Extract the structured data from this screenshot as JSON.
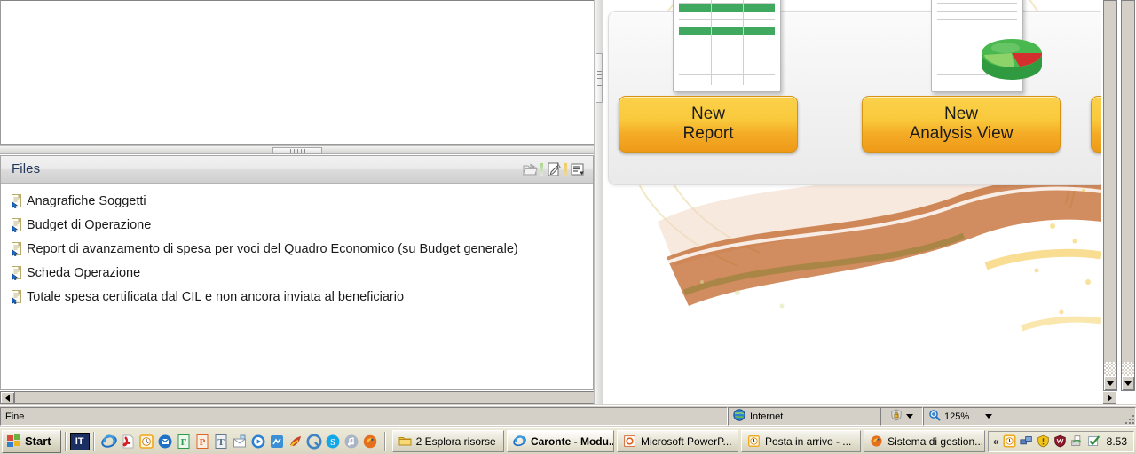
{
  "left_panel": {
    "top_pane": {
      "content": ""
    },
    "files_panel": {
      "title": "Files",
      "tools": [
        {
          "name": "open-folder-icon",
          "label": "Apri"
        },
        {
          "name": "edit-page-icon",
          "label": "Modifica"
        },
        {
          "name": "properties-list-icon",
          "label": "Proprietà"
        }
      ],
      "items": [
        {
          "icon": "document-shortcut-icon",
          "label": "Anagrafiche Soggetti"
        },
        {
          "icon": "document-shortcut-icon",
          "label": "Budget di Operazione"
        },
        {
          "icon": "document-shortcut-icon",
          "label": "Report di avanzamento di spesa per voci del Quadro Economico (su Budget generale)"
        },
        {
          "icon": "document-shortcut-icon",
          "label": "Scheda Operazione"
        },
        {
          "icon": "document-shortcut-icon",
          "label": "Totale spesa certificata dal CIL e non ancora inviata al beneficiario"
        }
      ]
    }
  },
  "main_pane": {
    "tiles": [
      {
        "id": "new-report",
        "line1": "New",
        "line2": "Report",
        "art": "spreadsheet-green"
      },
      {
        "id": "new-analysis-view",
        "line1": "New",
        "line2": "Analysis View",
        "art": "spreadsheet-pie"
      },
      {
        "id": "third-action",
        "line1": "",
        "line2": "",
        "art": "partial"
      }
    ]
  },
  "statusbar": {
    "message": "Fine",
    "zone": "Internet",
    "zone_icon": "globe-icon",
    "protected_icon": "lock-shield-icon",
    "zoom": "125%",
    "zoom_icon": "magnifier-plus-icon"
  },
  "taskbar": {
    "start_label": "Start",
    "language": "IT",
    "quicklaunch": [
      {
        "name": "internet-explorer-icon",
        "color": "#1f6fc4"
      },
      {
        "name": "acrobat-reader-icon",
        "color": "#d81f26"
      },
      {
        "name": "outlook-clock-icon",
        "color": "#f0a81e"
      },
      {
        "name": "outlook-icon",
        "color": "#1d72c8"
      },
      {
        "name": "frontpage-icon",
        "color": "#2e9a4a"
      },
      {
        "name": "powerpoint-icon",
        "color": "#e06425"
      },
      {
        "name": "word-icon",
        "color": "#64788c"
      },
      {
        "name": "mail-icon",
        "color": "#9aa3ad"
      },
      {
        "name": "media-player-icon",
        "color": "#2f7fd0"
      },
      {
        "name": "network-app-icon",
        "color": "#3b8fd6"
      },
      {
        "name": "ccleaner-icon",
        "color": "#c8442a"
      },
      {
        "name": "quicktime-icon",
        "color": "#3f83c4"
      },
      {
        "name": "skype-icon",
        "color": "#14a7e8"
      },
      {
        "name": "itunes-icon",
        "color": "#7f8fa4"
      },
      {
        "name": "firefox-icon",
        "color": "#e4701e"
      }
    ],
    "tasks": [
      {
        "icon": "folder-icon",
        "label": "2 Esplora risorse",
        "active": false,
        "group": true
      },
      {
        "icon": "internet-explorer-icon",
        "label": "Caronte - Modu...",
        "active": true,
        "group": false
      },
      {
        "icon": "powerpoint-icon",
        "label": "Microsoft PowerP...",
        "active": false,
        "group": false
      },
      {
        "icon": "outlook-clock-icon",
        "label": "Posta in arrivo - ...",
        "active": false,
        "group": false
      },
      {
        "icon": "firefox-icon",
        "label": "Sistema di gestion...",
        "active": false,
        "group": false
      }
    ],
    "tray": {
      "expand": "«",
      "icons": [
        {
          "name": "clock-icon",
          "color": "#f0a81e"
        },
        {
          "name": "network-icon",
          "color": "#3a6fbf"
        },
        {
          "name": "warning-shield-icon",
          "color": "#f0c419"
        },
        {
          "name": "antivirus-shield-icon",
          "color": "#8c1a2b"
        },
        {
          "name": "sync-icon",
          "color": "#3f9a4a"
        },
        {
          "name": "checkmark-icon",
          "color": "#2f8f3f"
        }
      ],
      "clock": "8.53"
    }
  }
}
